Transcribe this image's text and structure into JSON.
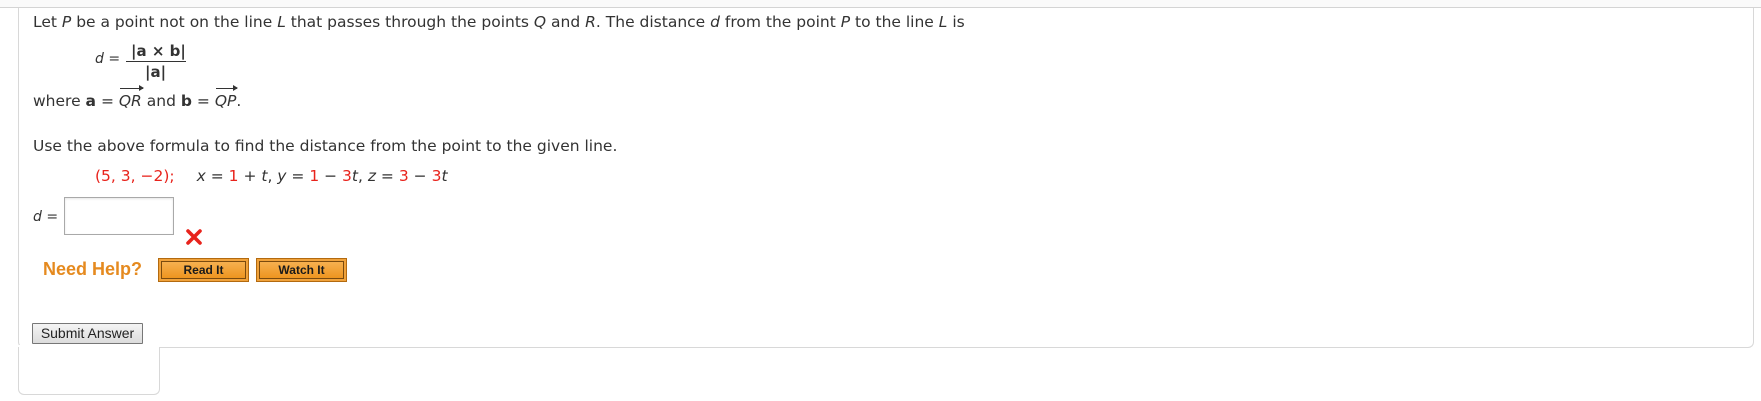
{
  "intro": {
    "p1": "Let ",
    "P": "P",
    "p2": " be a point not on the line ",
    "L": "L",
    "p3": " that passes through the points ",
    "Q": "Q",
    "p4": " and ",
    "R": "R",
    "p5": ". The distance ",
    "d": "d",
    "p6": " from the point ",
    "P2": "P",
    "p7": " to the line ",
    "L2": "L",
    "p8": " is"
  },
  "formula": {
    "lhs": "d",
    "eq": " =",
    "numerator": "|a × b|",
    "denominator": "|a|"
  },
  "where": {
    "w1": "where ",
    "a": "a",
    "eq1": " = ",
    "QR": "QR",
    "and": " and ",
    "b": "b",
    "eq2": " = ",
    "QP": "QP",
    "dot": "."
  },
  "instruction": "Use the above formula to find the distance from the point to the given line.",
  "problem": {
    "point": "(5, 3, −2);",
    "x_lbl": "x",
    "x_eq": " = ",
    "x_c": "1",
    "x_rest": " + ",
    "x_t": "t",
    "y_sep": ", ",
    "y_lbl": "y",
    "y_eq": " = ",
    "y_c": "1",
    "y_op": " − ",
    "y_k": "3",
    "y_t": "t",
    "z_sep": ", ",
    "z_lbl": "z",
    "z_eq": " = ",
    "z_c": "3",
    "z_op": " − ",
    "z_k": "3",
    "z_t": "t"
  },
  "answer": {
    "label_var": "d",
    "label_eq": " =",
    "value": "",
    "status": "incorrect",
    "status_color": "#e8231c"
  },
  "help": {
    "label": "Need Help?",
    "read_it": "Read It",
    "watch_it": "Watch It",
    "label_color": "#e58a1f"
  },
  "submit_label": "Submit Answer"
}
